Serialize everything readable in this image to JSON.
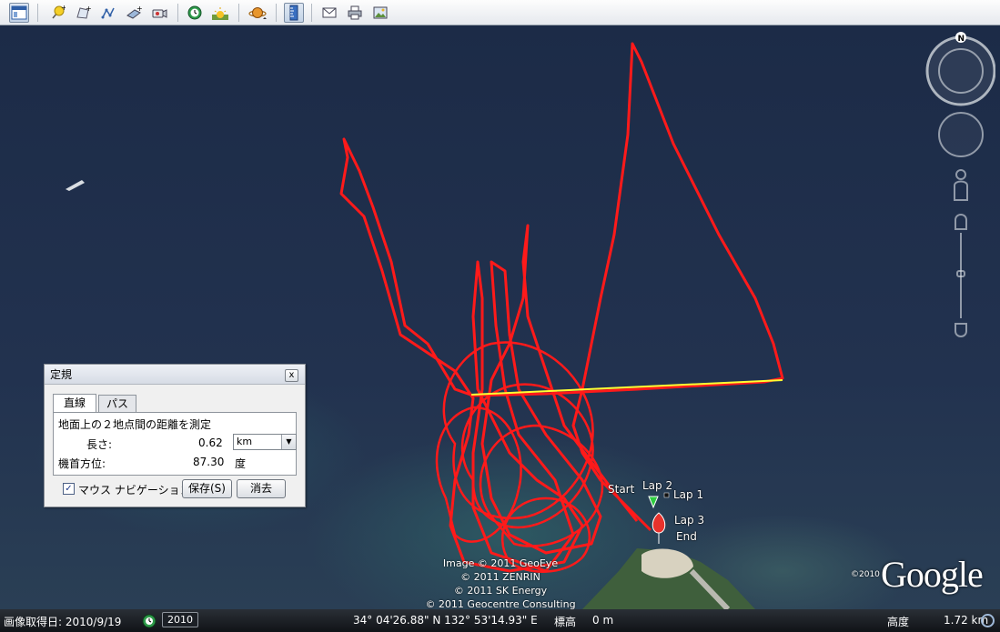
{
  "toolbar": {
    "buttons": [
      {
        "name": "sidebar-toggle",
        "icon": "sidebar-icon",
        "active": true
      },
      {
        "name": "add-placemark",
        "icon": "pushpin-add-icon"
      },
      {
        "name": "add-polygon",
        "icon": "polygon-add-icon"
      },
      {
        "name": "add-path",
        "icon": "path-add-icon"
      },
      {
        "name": "add-image-overlay",
        "icon": "image-overlay-icon"
      },
      {
        "name": "record-tour",
        "icon": "record-tour-icon"
      },
      {
        "name": "historical-imagery",
        "icon": "clock-icon"
      },
      {
        "name": "sunlight",
        "icon": "sun-icon"
      },
      {
        "name": "switch-planet",
        "icon": "planet-icon"
      },
      {
        "name": "ruler",
        "icon": "ruler-icon",
        "active": true
      },
      {
        "name": "email",
        "icon": "envelope-icon"
      },
      {
        "name": "print",
        "icon": "printer-icon"
      },
      {
        "name": "save-image",
        "icon": "image-save-icon"
      }
    ]
  },
  "map": {
    "labels": {
      "start": "Start",
      "lap2": "Lap 2",
      "lap1": "Lap 1",
      "lap3": "Lap 3",
      "end": "End"
    },
    "credits": [
      "Image © 2011 GeoEye",
      "© 2011 ZENRIN",
      "© 2011 SK Energy",
      "© 2011 Geocentre Consulting"
    ],
    "logo_year": "©2010",
    "logo_text": "Google",
    "compass_label": "N",
    "track_color": "#ff1a1a",
    "measure_color": "#ffff33"
  },
  "ruler": {
    "title": "定規",
    "close_label": "x",
    "tabs": [
      "直線",
      "パス"
    ],
    "description": "地面上の２地点間の距離を測定",
    "length_label": "長さ:",
    "length_value": "0.62",
    "unit": "km",
    "heading_label": "機首方位:",
    "heading_value": "87.30",
    "heading_unit": "度",
    "mouse_nav_label": "マウス ナビゲーション",
    "mouse_nav_checked": true,
    "save_label": "保存(S)",
    "clear_label": "消去"
  },
  "status": {
    "imagery_date": "画像取得日: 2010/9/19",
    "year": "2010",
    "coords": "34° 04'26.88\" N 132° 53'14.93\" E",
    "elevation_label": "標高",
    "elevation_value": "0 m",
    "altitude_label": "高度",
    "altitude_value": "1.72 km"
  }
}
